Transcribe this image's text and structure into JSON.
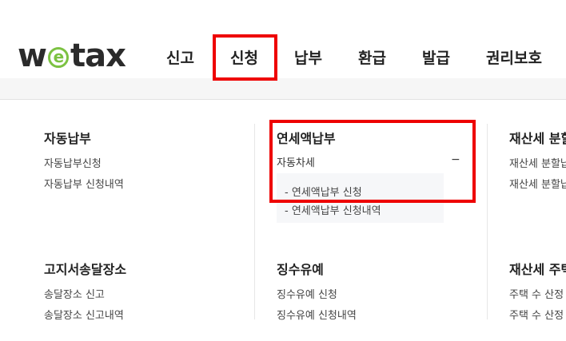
{
  "logo": {
    "prefix": "w",
    "e": "e",
    "suffix": "tax"
  },
  "gnb": [
    "신고",
    "신청",
    "납부",
    "환급",
    "발급",
    "권리보호"
  ],
  "menu": {
    "col1": {
      "group1": {
        "title": "자동납부",
        "links": [
          "자동납부신청",
          "자동납부 신청내역"
        ]
      },
      "group2": {
        "title": "고지서송달장소",
        "links": [
          "송달장소 신고",
          "송달장소 신고내역"
        ]
      }
    },
    "col2": {
      "group1": {
        "title": "연세액납부",
        "link": "자동차세",
        "toggle": "−",
        "sub": [
          "연세액납부 신청",
          "연세액납부 신청내역"
        ]
      },
      "group2": {
        "title": "징수유예",
        "links": [
          "징수유예 신청",
          "징수유예 신청내역"
        ]
      }
    },
    "col3": {
      "group1": {
        "title": "재산세 분할",
        "links": [
          "재산세 분할납",
          "재산세 분할납"
        ]
      },
      "group2": {
        "title": "재산세 주택",
        "links": [
          "주택 수 산정",
          "주택 수 산정"
        ]
      }
    }
  },
  "colors": {
    "highlight": "#ee0000",
    "logo_accent": "#7cc242"
  }
}
